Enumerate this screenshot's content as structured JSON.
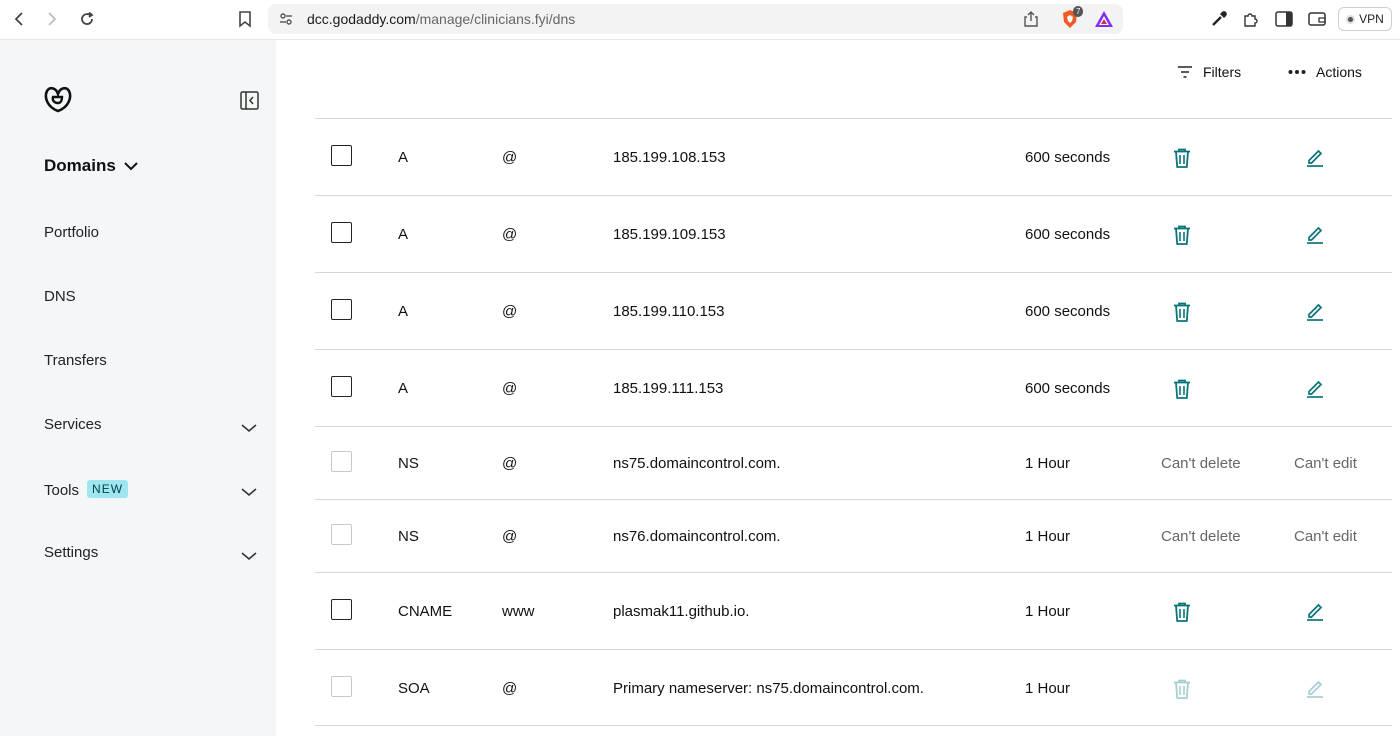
{
  "browser": {
    "url_host": "dcc.godaddy.com",
    "url_path": "/manage/clinicians.fyi/dns",
    "shield_count": "7",
    "vpn_label": "VPN"
  },
  "sidebar": {
    "section_title": "Domains",
    "items": [
      {
        "label": "Portfolio"
      },
      {
        "label": "DNS"
      },
      {
        "label": "Transfers"
      },
      {
        "label": "Services"
      },
      {
        "label": "Tools",
        "badge": "NEW"
      },
      {
        "label": "Settings"
      }
    ]
  },
  "toolbar": {
    "filters_label": "Filters",
    "actions_label": "Actions"
  },
  "records": [
    {
      "type": "A",
      "name": "@",
      "value": "185.199.108.153",
      "ttl": "600 seconds",
      "deletable": true,
      "editable": true
    },
    {
      "type": "A",
      "name": "@",
      "value": "185.199.109.153",
      "ttl": "600 seconds",
      "deletable": true,
      "editable": true
    },
    {
      "type": "A",
      "name": "@",
      "value": "185.199.110.153",
      "ttl": "600 seconds",
      "deletable": true,
      "editable": true
    },
    {
      "type": "A",
      "name": "@",
      "value": "185.199.111.153",
      "ttl": "600 seconds",
      "deletable": true,
      "editable": true
    },
    {
      "type": "NS",
      "name": "@",
      "value": "ns75.domaincontrol.com.",
      "ttl": "1 Hour",
      "delete_text": "Can't delete",
      "edit_text": "Can't edit"
    },
    {
      "type": "NS",
      "name": "@",
      "value": "ns76.domaincontrol.com.",
      "ttl": "1 Hour",
      "delete_text": "Can't delete",
      "edit_text": "Can't edit"
    },
    {
      "type": "CNAME",
      "name": "www",
      "value": "plasmak11.github.io.",
      "ttl": "1 Hour",
      "deletable": true,
      "editable": true
    },
    {
      "type": "SOA",
      "name": "@",
      "value": "Primary nameserver: ns75.domaincontrol.com.",
      "ttl": "1 Hour",
      "deletable": false,
      "editable": false
    }
  ],
  "colors": {
    "accent": "#09757a",
    "accent_disabled": "#a6cfd1",
    "sidebar_bg": "#f4f6f8"
  }
}
